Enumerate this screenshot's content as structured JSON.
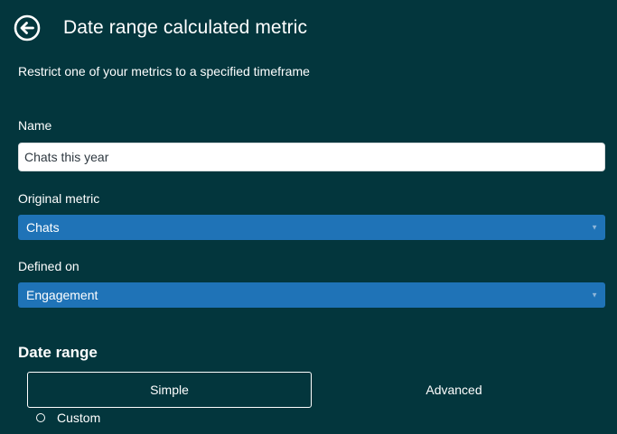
{
  "header": {
    "back_icon": "back-arrow-circle-icon",
    "title": "Date range calculated metric"
  },
  "subtitle": "Restrict one of your metrics to a specified timeframe",
  "form": {
    "name": {
      "label": "Name",
      "value": "Chats this year"
    },
    "original_metric": {
      "label": "Original metric",
      "selected": "Chats"
    },
    "defined_on": {
      "label": "Defined on",
      "selected": "Engagement"
    }
  },
  "date_range": {
    "title": "Date range",
    "tabs": [
      {
        "label": "Simple",
        "active": true
      },
      {
        "label": "Advanced",
        "active": false
      }
    ],
    "options": [
      {
        "label": "Custom",
        "selected": false
      }
    ]
  },
  "colors": {
    "background": "#03363d",
    "select_background": "#1f73b7",
    "text": "#ffffff",
    "input_text": "#2f3941"
  }
}
